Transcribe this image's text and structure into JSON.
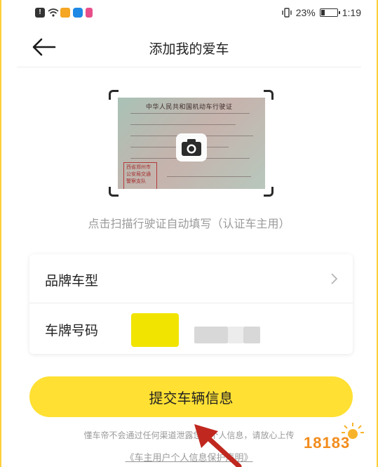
{
  "status_bar": {
    "battery": "23%",
    "battery_level": 0.23,
    "time": "1:19",
    "icons": [
      "alert-icon",
      "wifi-icon",
      "weibo-app-icon",
      "browser-app-icon",
      "app-icon"
    ]
  },
  "header": {
    "title": "添加我的爱车",
    "back_icon": "arrow-left-icon"
  },
  "scan": {
    "license_title": "中华人民共和国机动车行驶证",
    "stamp_text": "西省郑州市公安局交通警察支队",
    "camera_icon": "camera-icon",
    "hint": "点击扫描行驶证自动填写（认证车主用）"
  },
  "form": {
    "brand_label": "品牌车型",
    "plate_label": "车牌号码",
    "chevron_icon": "chevron-right-icon"
  },
  "submit_label": "提交车辆信息",
  "privacy_note": "懂车帝不会通过任何渠道泄露您的个人信息，请放心上传",
  "privacy_link": "《车主用户个人信息保护声明》",
  "watermark": "18183",
  "colors": {
    "accent": "#ffe033",
    "plate": "#f1e400",
    "border": "#ffcf3a",
    "annotation_arrow": "#c0281f"
  }
}
